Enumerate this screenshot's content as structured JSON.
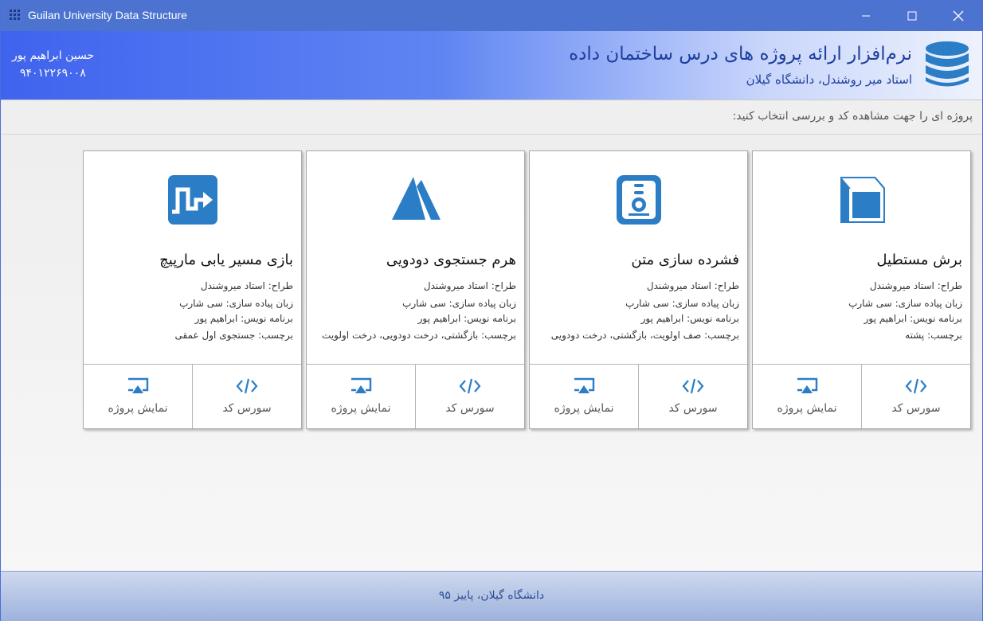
{
  "window": {
    "title": "Guilan University Data Structure",
    "accent": "#4c73cf"
  },
  "header": {
    "title": "نرم‌افزار ارائه پروژه های درس ساختمان داده",
    "subtitle": "استاد میر روشندل، دانشگاه گیلان",
    "author_name": "حسین ابراهیم پور",
    "author_id": "۹۴۰۱۲۲۶۹۰۰۸",
    "icon": "database-icon",
    "title_color": "#1d3f9e"
  },
  "instruction": "پروژه ای را جهت مشاهده کد و بررسی انتخاب کنید:",
  "cards": [
    {
      "icon": "box-icon",
      "title": "برش مستطیل",
      "designer": "طراح: استاد میروشندل",
      "language": "زبان پیاده سازی: سی شارپ",
      "programmer": "برنامه نویس: ابراهیم پور",
      "tags": "برچسب: پشته",
      "source_label": "سورس کد",
      "show_label": "نمایش پروژه"
    },
    {
      "icon": "id-badge-icon",
      "title": "فشرده سازی متن",
      "designer": "طراح: استاد میروشندل",
      "language": "زبان پیاده سازی: سی شارپ",
      "programmer": "برنامه نویس: ابراهیم پور",
      "tags": "برچسب: صف اولویت، بازگشتی، درخت دودویی",
      "source_label": "سورس کد",
      "show_label": "نمایش پروژه"
    },
    {
      "icon": "pyramid-icon",
      "title": "هرم جستجوی دودویی",
      "designer": "طراح: استاد میروشندل",
      "language": "زبان پیاده سازی: سی شارپ",
      "programmer": "برنامه نویس: ابراهیم پور",
      "tags": "برچسب: بازگشتی، درخت دودویی، درخت اولویت",
      "source_label": "سورس کد",
      "show_label": "نمایش پروژه"
    },
    {
      "icon": "maze-path-icon",
      "title": "بازی مسیر یابی مارپیچ",
      "designer": "طراح: استاد میروشندل",
      "language": "زبان پیاده سازی: سی شارپ",
      "programmer": "برنامه نویس: ابراهیم پور",
      "tags": "برچسب: جستجوی اول عمقی",
      "source_label": "سورس کد",
      "show_label": "نمایش پروژه"
    }
  ],
  "icon_color": "#2b7dc6",
  "footer": "دانشگاه گیلان، پاییز ۹۵"
}
